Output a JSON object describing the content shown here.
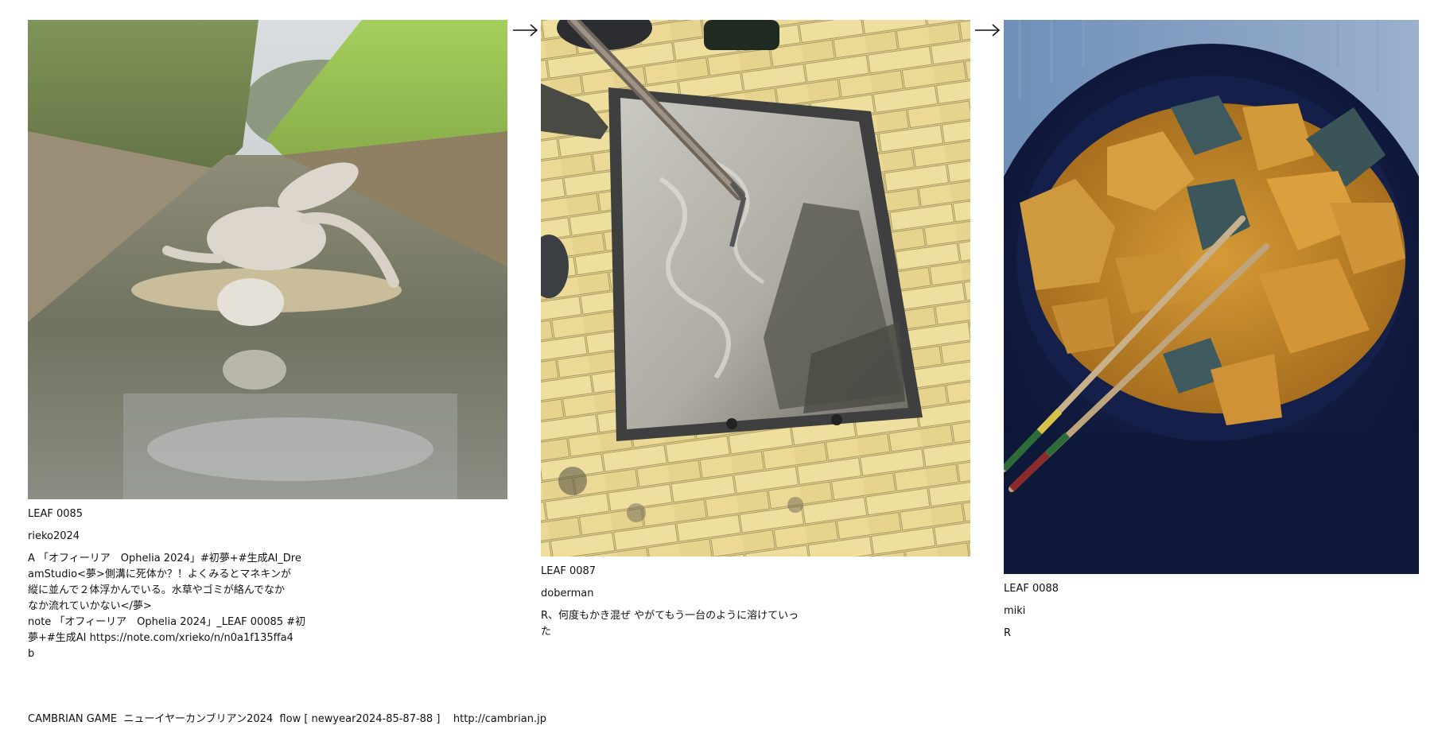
{
  "leaves": [
    {
      "id": "LEAF 0085",
      "author": "rieko2024",
      "text": "A 「オフィーリア　Ophelia 2024」#初夢+#生成AI_Dre\namStudio<夢>側溝に死体か？！よくみるとマネキンが\n縦に並んで２体浮かんでいる。水草やゴミが絡んでなか\nなか流れていかない</夢>\nnote 「オフィーリア　Ophelia 2024」_LEAF 00085 #初\n夢+#生成AI https://note.com/xrieko/n/n0a1f135ffa4\nb"
    },
    {
      "id": "LEAF 0087",
      "author": "doberman",
      "text": "R、何度もかき混ぜ やがてもう一台のように溶けていっ\nた"
    },
    {
      "id": "LEAF 0088",
      "author": "miki",
      "text": "R"
    }
  ],
  "arrows": [
    "arrow-right-icon",
    "arrow-right-icon"
  ],
  "footer": "CAMBRIAN GAME  ニューイヤーカンブリアン2024  flow [ newyear2024-85-87-88 ]    http://cambrian.jp"
}
